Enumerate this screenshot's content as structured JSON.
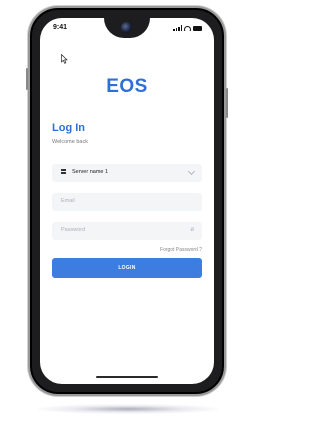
{
  "status_bar": {
    "time": "9:41",
    "icons": [
      "signal-icon",
      "wifi-icon",
      "battery-icon"
    ]
  },
  "brand": {
    "logo_text": "EOS",
    "accent_color": "#2f6fd6"
  },
  "login": {
    "title": "Log In",
    "subtitle": "Welcome back",
    "server_select_value": "Server name 1",
    "email_placeholder": "Email",
    "password_placeholder": "Password",
    "forgot_password_label": "Forgot Password ?",
    "login_button_label": "LOGIN",
    "button_color": "#3d7de0"
  }
}
